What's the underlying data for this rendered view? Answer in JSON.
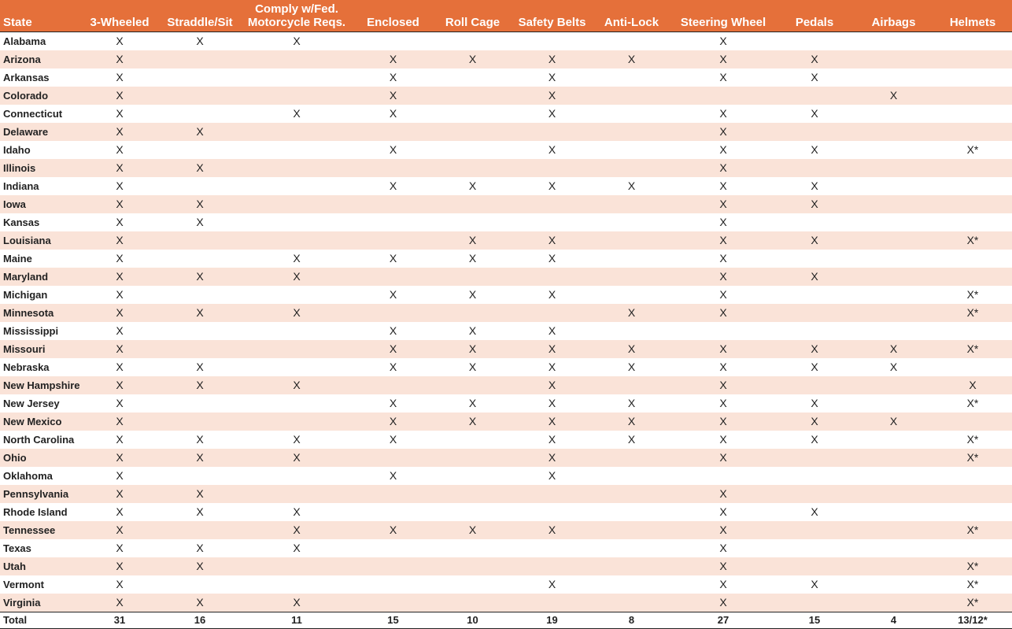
{
  "headers": [
    {
      "line1": "",
      "line2": "State"
    },
    {
      "line1": "",
      "line2": "3-Wheeled"
    },
    {
      "line1": "",
      "line2": "Straddle/Sit"
    },
    {
      "line1": "Comply w/Fed.",
      "line2": "Motorcycle Reqs."
    },
    {
      "line1": "",
      "line2": "Enclosed"
    },
    {
      "line1": "",
      "line2": "Roll Cage"
    },
    {
      "line1": "",
      "line2": "Safety Belts"
    },
    {
      "line1": "",
      "line2": "Anti-Lock"
    },
    {
      "line1": "",
      "line2": "Steering Wheel"
    },
    {
      "line1": "",
      "line2": "Pedals"
    },
    {
      "line1": "",
      "line2": "Airbags"
    },
    {
      "line1": "",
      "line2": "Helmets"
    }
  ],
  "rows": [
    {
      "state": "Alabama",
      "cells": [
        "X",
        "X",
        "X",
        "",
        "",
        "",
        "",
        "X",
        "",
        "",
        ""
      ]
    },
    {
      "state": "Arizona",
      "cells": [
        "X",
        "",
        "",
        "X",
        "X",
        "X",
        "X",
        "X",
        "X",
        "",
        ""
      ]
    },
    {
      "state": "Arkansas",
      "cells": [
        "X",
        "",
        "",
        "X",
        "",
        "X",
        "",
        "X",
        "X",
        "",
        ""
      ]
    },
    {
      "state": "Colorado",
      "cells": [
        "X",
        "",
        "",
        "X",
        "",
        "X",
        "",
        "",
        "",
        "X",
        ""
      ]
    },
    {
      "state": "Connecticut",
      "cells": [
        "X",
        "",
        "X",
        "X",
        "",
        "X",
        "",
        "X",
        "X",
        "",
        ""
      ]
    },
    {
      "state": "Delaware",
      "cells": [
        "X",
        "X",
        "",
        "",
        "",
        "",
        "",
        "X",
        "",
        "",
        ""
      ]
    },
    {
      "state": "Idaho",
      "cells": [
        "X",
        "",
        "",
        "X",
        "",
        "X",
        "",
        "X",
        "X",
        "",
        "X*"
      ]
    },
    {
      "state": "Illinois",
      "cells": [
        "X",
        "X",
        "",
        "",
        "",
        "",
        "",
        "X",
        "",
        "",
        ""
      ]
    },
    {
      "state": "Indiana",
      "cells": [
        "X",
        "",
        "",
        "X",
        "X",
        "X",
        "X",
        "X",
        "X",
        "",
        ""
      ]
    },
    {
      "state": "Iowa",
      "cells": [
        "X",
        "X",
        "",
        "",
        "",
        "",
        "",
        "X",
        "X",
        "",
        ""
      ]
    },
    {
      "state": "Kansas",
      "cells": [
        "X",
        "X",
        "",
        "",
        "",
        "",
        "",
        "X",
        "",
        "",
        ""
      ]
    },
    {
      "state": "Louisiana",
      "cells": [
        "X",
        "",
        "",
        "",
        "X",
        "X",
        "",
        "X",
        "X",
        "",
        "X*"
      ]
    },
    {
      "state": "Maine",
      "cells": [
        "X",
        "",
        "X",
        "X",
        "X",
        "X",
        "",
        "X",
        "",
        "",
        ""
      ]
    },
    {
      "state": "Maryland",
      "cells": [
        "X",
        "X",
        "X",
        "",
        "",
        "",
        "",
        "X",
        "X",
        "",
        ""
      ]
    },
    {
      "state": "Michigan",
      "cells": [
        "X",
        "",
        "",
        "X",
        "X",
        "X",
        "",
        "X",
        "",
        "",
        "X*"
      ]
    },
    {
      "state": "Minnesota",
      "cells": [
        "X",
        "X",
        "X",
        "",
        "",
        "",
        "X",
        "X",
        "",
        "",
        "X*"
      ]
    },
    {
      "state": "Mississippi",
      "cells": [
        "X",
        "",
        "",
        "X",
        "X",
        "X",
        "",
        "",
        "",
        "",
        ""
      ]
    },
    {
      "state": "Missouri",
      "cells": [
        "X",
        "",
        "",
        "X",
        "X",
        "X",
        "X",
        "X",
        "X",
        "X",
        "X*"
      ]
    },
    {
      "state": "Nebraska",
      "cells": [
        "X",
        "X",
        "",
        "X",
        "X",
        "X",
        "X",
        "X",
        "X",
        "X",
        ""
      ]
    },
    {
      "state": "New Hampshire",
      "cells": [
        "X",
        "X",
        "X",
        "",
        "",
        "X",
        "",
        "X",
        "",
        "",
        "X"
      ]
    },
    {
      "state": "New Jersey",
      "cells": [
        "X",
        "",
        "",
        "X",
        "X",
        "X",
        "X",
        "X",
        "X",
        "",
        "X*"
      ]
    },
    {
      "state": "New Mexico",
      "cells": [
        "X",
        "",
        "",
        "X",
        "X",
        "X",
        "X",
        "X",
        "X",
        "X",
        ""
      ]
    },
    {
      "state": "North Carolina",
      "cells": [
        "X",
        "X",
        "X",
        "X",
        "",
        "X",
        "X",
        "X",
        "X",
        "",
        "X*"
      ]
    },
    {
      "state": "Ohio",
      "cells": [
        "X",
        "X",
        "X",
        "",
        "",
        "X",
        "",
        "X",
        "",
        "",
        "X*"
      ]
    },
    {
      "state": "Oklahoma",
      "cells": [
        "X",
        "",
        "",
        "X",
        "",
        "X",
        "",
        "",
        "",
        "",
        ""
      ]
    },
    {
      "state": "Pennsylvania",
      "cells": [
        "X",
        "X",
        "",
        "",
        "",
        "",
        "",
        "X",
        "",
        "",
        ""
      ]
    },
    {
      "state": "Rhode Island",
      "cells": [
        "X",
        "X",
        "X",
        "",
        "",
        "",
        "",
        "X",
        "X",
        "",
        ""
      ]
    },
    {
      "state": "Tennessee",
      "cells": [
        "X",
        "",
        "X",
        "X",
        "X",
        "X",
        "",
        "X",
        "",
        "",
        "X*"
      ]
    },
    {
      "state": "Texas",
      "cells": [
        "X",
        "X",
        "X",
        "",
        "",
        "",
        "",
        "X",
        "",
        "",
        ""
      ]
    },
    {
      "state": "Utah",
      "cells": [
        "X",
        "X",
        "",
        "",
        "",
        "",
        "",
        "X",
        "",
        "",
        "X*"
      ]
    },
    {
      "state": "Vermont",
      "cells": [
        "X",
        "",
        "",
        "",
        "",
        "X",
        "",
        "X",
        "X",
        "",
        "X*"
      ]
    },
    {
      "state": "Virginia",
      "cells": [
        "X",
        "X",
        "X",
        "",
        "",
        "",
        "",
        "X",
        "",
        "",
        "X*"
      ]
    }
  ],
  "total": {
    "label": "Total",
    "values": [
      "31",
      "16",
      "11",
      "15",
      "10",
      "19",
      "8",
      "27",
      "15",
      "4",
      "13/12*"
    ]
  }
}
